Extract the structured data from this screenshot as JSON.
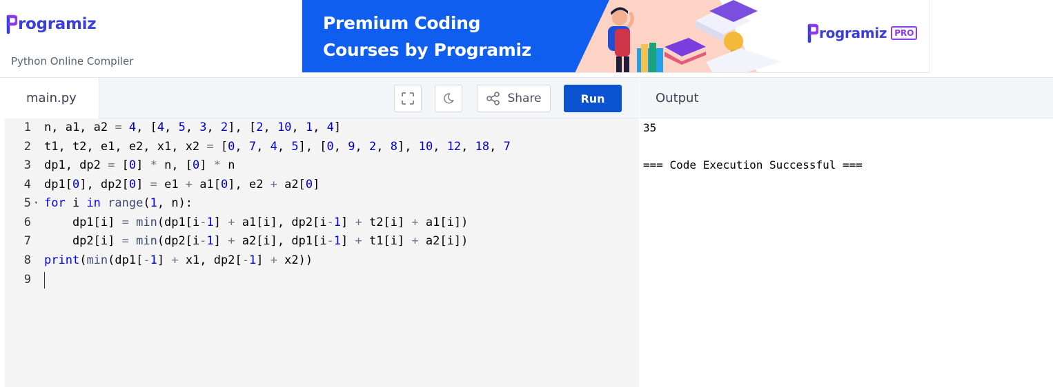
{
  "header": {
    "logo_text": "rogramiz",
    "subtitle": "Python Online Compiler"
  },
  "banner": {
    "headline_line1": "Premium Coding",
    "headline_line2": "Courses by Programiz",
    "logo_text": "rogramiz",
    "badge": "PRO"
  },
  "editor": {
    "tab_label": "main.py",
    "share_label": "Share",
    "run_label": "Run",
    "line_numbers": [
      "1",
      "2",
      "3",
      "4",
      "5",
      "6",
      "7",
      "8",
      "9"
    ],
    "lines": [
      "n, a1, a2 = 4, [4, 5, 3, 2], [2, 10, 1, 4]",
      "t1, t2, e1, e2, x1, x2 = [0, 7, 4, 5], [0, 9, 2, 8], 10, 12, 18, 7",
      "dp1, dp2 = [0] * n, [0] * n",
      "dp1[0], dp2[0] = e1 + a1[0], e2 + a2[0]",
      "for i in range(1, n):",
      "    dp1[i] = min(dp1[i-1] + a1[i], dp2[i-1] + t2[i] + a1[i])",
      "    dp2[i] = min(dp2[i-1] + a2[i], dp1[i-1] + t1[i] + a2[i])",
      "print(min(dp1[-1] + x1, dp2[-1] + x2))",
      ""
    ],
    "active_line": 9
  },
  "output": {
    "title": "Output",
    "lines": [
      "35",
      "",
      "=== Code Execution Successful ==="
    ]
  },
  "colors": {
    "brand": "#3b3fd8",
    "run_button": "#0b52d1",
    "banner_blue": "#0f5ef0",
    "keyword": "#0000ff",
    "number": "#0000cd"
  },
  "icons": [
    "fullscreen-icon",
    "moon-icon",
    "share-icon",
    "fold-arrow-icon"
  ]
}
